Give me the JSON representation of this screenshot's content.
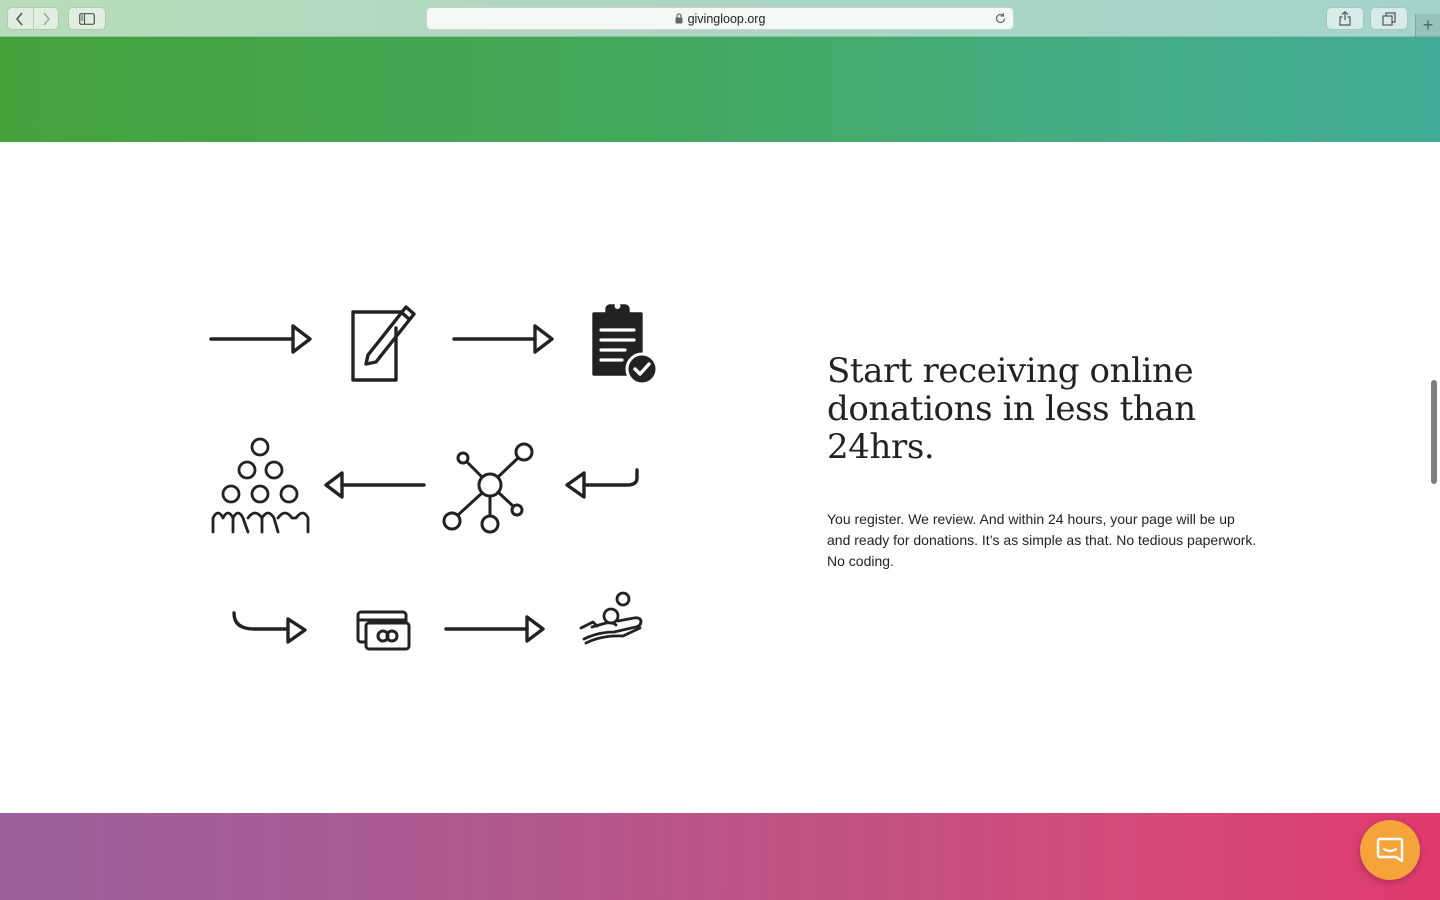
{
  "browser": {
    "url": "givingloop.org",
    "icons": {
      "back": "chevron-left-icon",
      "forward": "chevron-right-icon",
      "sidebar": "sidebar-icon",
      "lock": "lock-icon",
      "reload": "reload-icon",
      "share": "share-icon",
      "tabs": "tabs-icon",
      "new_tab": "plus-icon"
    },
    "new_tab_label": "+"
  },
  "section": {
    "headline": "Start receiving online donations in less than 24hrs.",
    "body": "You register. We review. And within 24 hours, your page will be up and ready for donations. It’s as simple as that. No tedious paperwork. No coding."
  },
  "illustration": {
    "steps": [
      "arrow-right-icon",
      "edit-form-icon",
      "arrow-right-icon",
      "clipboard-check-icon",
      "return-arrow-icon",
      "network-icon",
      "arrow-left-icon",
      "people-group-icon",
      "curved-arrow-icon",
      "credit-card-icon",
      "arrow-right-icon",
      "hand-coins-icon"
    ]
  },
  "colors": {
    "top_band_start": "#45a33c",
    "top_band_end": "#43aa97",
    "bottom_band_start": "#9b619d",
    "bottom_band_end": "#e13a6e",
    "chat_button": "#f4a43a",
    "text": "#222222"
  },
  "chat": {
    "icon": "chat-icon"
  }
}
